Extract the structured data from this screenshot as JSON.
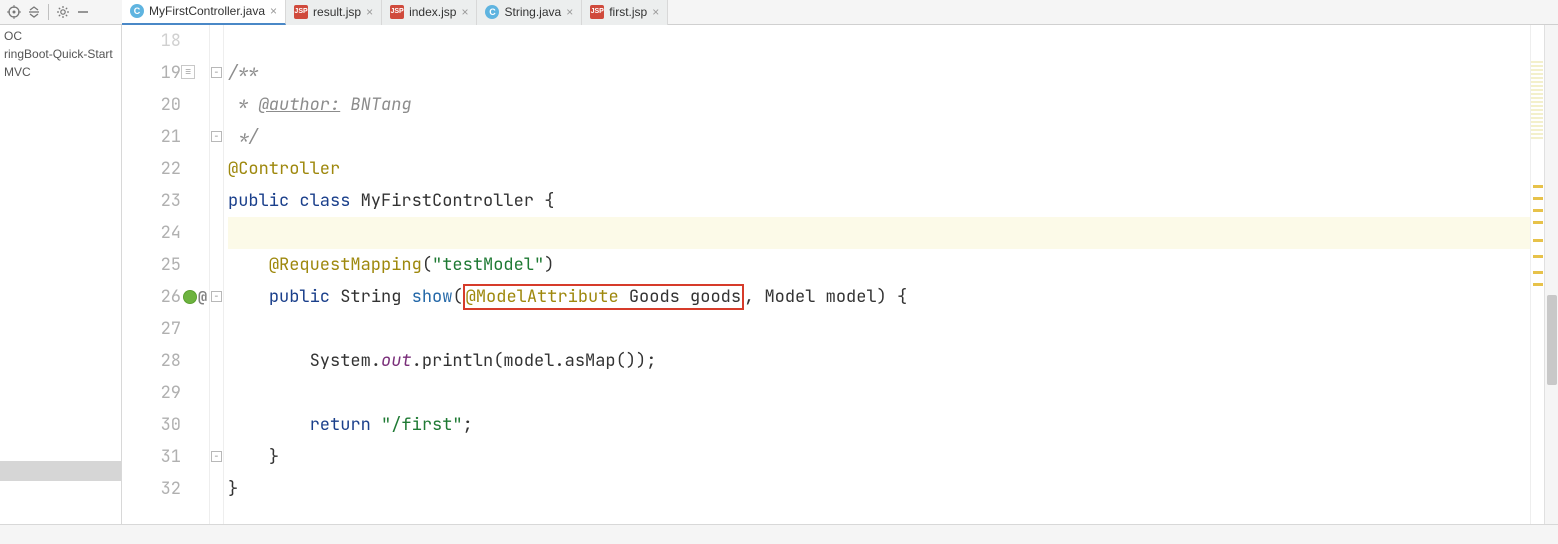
{
  "toolbar": {
    "icons": [
      "target",
      "collapse",
      "gear",
      "minimize"
    ]
  },
  "tabs": [
    {
      "icon": "java",
      "iconText": "C",
      "label": "MyFirstController.java",
      "active": true
    },
    {
      "icon": "jsp",
      "iconText": "JSP",
      "label": "result.jsp",
      "active": false
    },
    {
      "icon": "jsp",
      "iconText": "JSP",
      "label": "index.jsp",
      "active": false
    },
    {
      "icon": "java",
      "iconText": "C",
      "label": "String.java",
      "active": false
    },
    {
      "icon": "jsp",
      "iconText": "JSP",
      "label": "first.jsp",
      "active": false
    }
  ],
  "sidebar": {
    "items": [
      "OC",
      "ringBoot-Quick-Start",
      "MVC"
    ],
    "selectedIndex": 2
  },
  "editor": {
    "firstLine": 18,
    "currentLine": 24,
    "gutterAnnotations": {
      "26": [
        "spring",
        "@"
      ]
    },
    "highlightBox": {
      "line": 26,
      "text": "@ModelAttribute Goods goods"
    },
    "lines": [
      {
        "n": 18,
        "up": true,
        "tokens": []
      },
      {
        "n": 19,
        "tokens": [
          {
            "t": "/**",
            "cls": "c-comment"
          }
        ]
      },
      {
        "n": 20,
        "tokens": [
          {
            "t": " * ",
            "cls": "c-comment"
          },
          {
            "t": "@author:",
            "cls": "c-doctag"
          },
          {
            "t": " BNTang",
            "cls": "c-comment"
          }
        ]
      },
      {
        "n": 21,
        "tokens": [
          {
            "t": " */",
            "cls": "c-comment"
          }
        ]
      },
      {
        "n": 22,
        "tokens": [
          {
            "t": "@Controller",
            "cls": "c-anno"
          }
        ]
      },
      {
        "n": 23,
        "tokens": [
          {
            "t": "public ",
            "cls": "c-keyword"
          },
          {
            "t": "class ",
            "cls": "c-keyword"
          },
          {
            "t": "MyFirstController {",
            "cls": "c-class"
          }
        ]
      },
      {
        "n": 24,
        "current": true,
        "tokens": []
      },
      {
        "n": 25,
        "indent": 1,
        "tokens": [
          {
            "t": "@RequestMapping",
            "cls": "c-anno"
          },
          {
            "t": "(",
            "cls": "c-plain"
          },
          {
            "t": "\"testModel\"",
            "cls": "c-string"
          },
          {
            "t": ")",
            "cls": "c-plain"
          }
        ]
      },
      {
        "n": 26,
        "indent": 1,
        "tokens": [
          {
            "t": "public ",
            "cls": "c-keyword"
          },
          {
            "t": "String ",
            "cls": "c-class"
          },
          {
            "t": "show",
            "cls": "c-method"
          },
          {
            "t": "(",
            "cls": "c-plain"
          },
          {
            "box": true,
            "inner": [
              {
                "t": "@ModelAttribute",
                "cls": "c-anno"
              },
              {
                "t": " Goods goods",
                "cls": "c-plain"
              }
            ]
          },
          {
            "t": ", Model model) {",
            "cls": "c-plain"
          }
        ]
      },
      {
        "n": 27,
        "tokens": []
      },
      {
        "n": 28,
        "indent": 2,
        "tokens": [
          {
            "t": "System.",
            "cls": "c-plain"
          },
          {
            "t": "out",
            "cls": "c-static"
          },
          {
            "t": ".println(model.asMap());",
            "cls": "c-plain"
          }
        ]
      },
      {
        "n": 29,
        "tokens": []
      },
      {
        "n": 30,
        "indent": 2,
        "tokens": [
          {
            "t": "return ",
            "cls": "c-keyword"
          },
          {
            "t": "\"/first\"",
            "cls": "c-string"
          },
          {
            "t": ";",
            "cls": "c-plain"
          }
        ]
      },
      {
        "n": 31,
        "indent": 1,
        "tokens": [
          {
            "t": "}",
            "cls": "c-plain"
          }
        ]
      },
      {
        "n": 32,
        "tokens": [
          {
            "t": "}",
            "cls": "c-plain"
          }
        ]
      }
    ]
  },
  "markers": {
    "warning_positions": [
      160,
      172,
      184,
      196,
      214,
      230,
      246,
      258
    ]
  }
}
